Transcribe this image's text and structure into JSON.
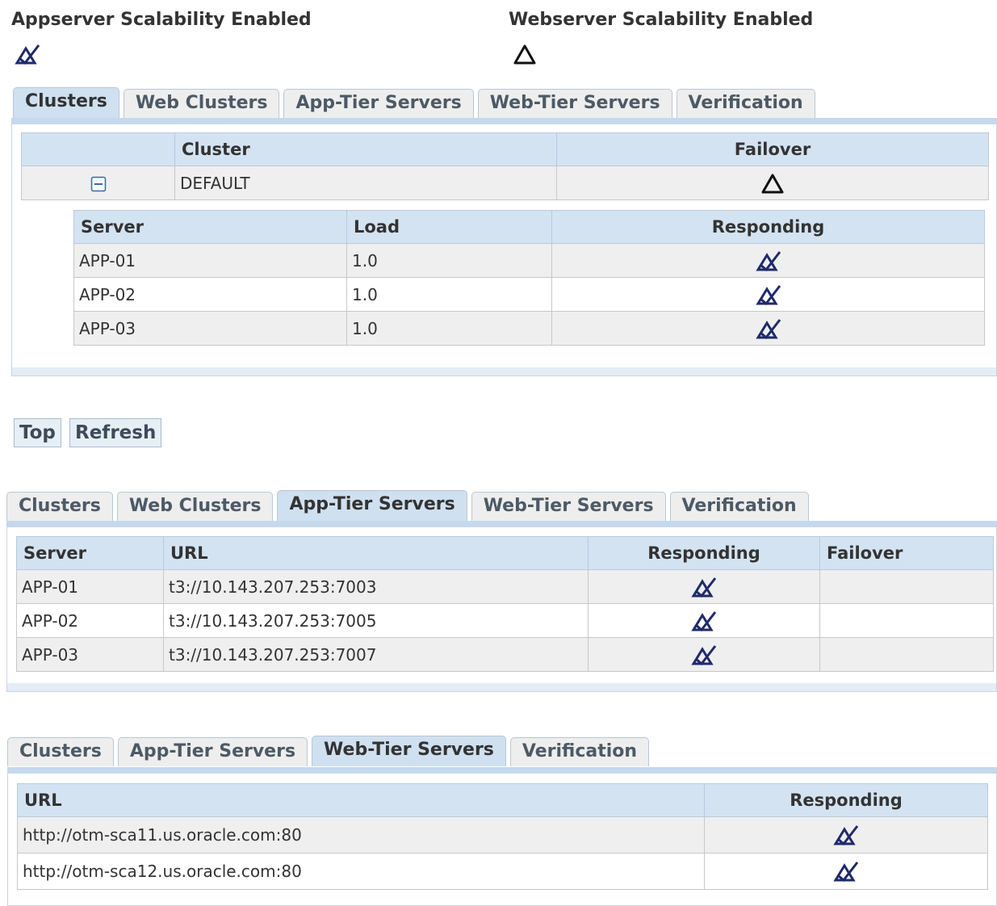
{
  "header": {
    "appserver_label": "Appserver Scalability Enabled",
    "appserver_icon": "checkmark-icon",
    "webserver_label": "Webserver Scalability Enabled",
    "webserver_icon": "triangle-warning-icon"
  },
  "section1": {
    "tabs": [
      "Clusters",
      "Web Clusters",
      "App-Tier Servers",
      "Web-Tier Servers",
      "Verification"
    ],
    "active_tab": "Clusters",
    "cluster_headers": {
      "blank": "",
      "cluster": "Cluster",
      "failover": "Failover"
    },
    "cluster": {
      "name": "DEFAULT",
      "failover_icon": "triangle-warning-icon",
      "collapse_icon": "collapse-minus-icon"
    },
    "server_headers": {
      "server": "Server",
      "load": "Load",
      "responding": "Responding"
    },
    "servers": [
      {
        "server": "APP-01",
        "load": "1.0",
        "responding_icon": "checkmark-icon"
      },
      {
        "server": "APP-02",
        "load": "1.0",
        "responding_icon": "checkmark-icon"
      },
      {
        "server": "APP-03",
        "load": "1.0",
        "responding_icon": "checkmark-icon"
      }
    ]
  },
  "buttons": {
    "top": "Top",
    "refresh": "Refresh"
  },
  "section2": {
    "tabs": [
      "Clusters",
      "Web Clusters",
      "App-Tier Servers",
      "Web-Tier Servers",
      "Verification"
    ],
    "active_tab": "App-Tier Servers",
    "headers": {
      "server": "Server",
      "url": "URL",
      "responding": "Responding",
      "failover": "Failover"
    },
    "rows": [
      {
        "server": "APP-01",
        "url": "t3://10.143.207.253:7003",
        "responding_icon": "checkmark-icon",
        "failover": ""
      },
      {
        "server": "APP-02",
        "url": "t3://10.143.207.253:7005",
        "responding_icon": "checkmark-icon",
        "failover": ""
      },
      {
        "server": "APP-03",
        "url": "t3://10.143.207.253:7007",
        "responding_icon": "checkmark-icon",
        "failover": ""
      }
    ]
  },
  "section3": {
    "tabs": [
      "Clusters",
      "App-Tier Servers",
      "Web-Tier Servers",
      "Verification"
    ],
    "active_tab": "Web-Tier Servers",
    "headers": {
      "url": "URL",
      "responding": "Responding"
    },
    "rows": [
      {
        "url": "http://otm-sca11.us.oracle.com:80",
        "responding_icon": "checkmark-icon"
      },
      {
        "url": "http://otm-sca12.us.oracle.com:80",
        "responding_icon": "checkmark-icon"
      }
    ]
  },
  "colors": {
    "tab_active": "#cfe0f0",
    "header_bg": "#d4e3f2",
    "icon_navy": "#1f2a6b"
  }
}
